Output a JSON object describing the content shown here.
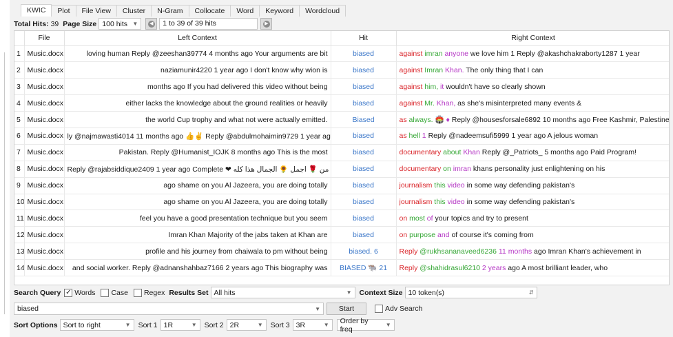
{
  "tabs": [
    "KWIC",
    "Plot",
    "File View",
    "Cluster",
    "N-Gram",
    "Collocate",
    "Word",
    "Keyword",
    "Wordcloud"
  ],
  "hits": {
    "total_label": "Total Hits:",
    "total": "39",
    "page_size_label": "Page Size",
    "page_size": "100 hits",
    "range": "1 to 39 of 39 hits"
  },
  "columns": [
    "",
    "File",
    "Left Context",
    "Hit",
    "Right Context"
  ],
  "rows": [
    {
      "n": "1",
      "file": "Music.docx",
      "left": "loving human Reply @zeeshan39774 4 months ago Your arguments are bit",
      "hit": "biased",
      "r1": "against",
      "r2": "imran",
      "r3": "anyone",
      "rest": "we love him 1 Reply @akashchakraborty1287 1 year"
    },
    {
      "n": "2",
      "file": "Music.docx",
      "left": "naziamunir4220 1 year ago I don't know why wion is",
      "hit": "biased",
      "r1": "against",
      "r2": "Imran",
      "r3": "Khan.",
      "rest": "The only thing that I can"
    },
    {
      "n": "3",
      "file": "Music.docx",
      "left": "months ago If you had delivered this video without being",
      "hit": "biased",
      "r1": "against",
      "r2": "him,",
      "r3": "it",
      "rest": "wouldn't have so clearly shown"
    },
    {
      "n": "4",
      "file": "Music.docx",
      "left": "either lacks the knowledge about the ground realities or heavily",
      "hit": "biased",
      "r1": "against",
      "r2": "Mr.",
      "r3": "Khan,",
      "rest": "as she's misinterpreted many events &"
    },
    {
      "n": "5",
      "file": "Music.docx",
      "left": "the world Cup trophy and what not were actually emitted.",
      "hit": "Biased",
      "r1": "as",
      "r2": "always.",
      "r3": "🏟️ ♦",
      "rest": "Reply @housesforsale6892 10 months ago Free Kashmir, Palestine."
    },
    {
      "n": "6",
      "file": "Music.docx",
      "left": "ly @najmawasti4014 11 months ago 👍✌ Reply @abdulmohaimin9729 1 year ago",
      "hit": "biased",
      "r1": "as",
      "r2": "hell",
      "r3": "1",
      "rest": "Reply @nadeemsufi5999 1 year ago A jelous woman"
    },
    {
      "n": "7",
      "file": "Music.docx",
      "left": "Pakistan. Reply @Humanist_IOJK 8 months ago This is the most",
      "hit": "biased",
      "r1": "documentary",
      "r2": "about",
      "r3": "Khan",
      "rest": "Reply @_Patriots_ 5 months ago Paid Program!"
    },
    {
      "n": "8",
      "file": "Music.docx",
      "left": "Reply @rajabsiddique2409 1 year ago Complete ❤ من 🌹 اجمل 🌻 الجمال هذا كله",
      "hit": "biased",
      "r1": "documentary",
      "r2": "on",
      "r3": "imran",
      "rest": "khans personality just enlightening on his"
    },
    {
      "n": "9",
      "file": "Music.docx",
      "left": "ago shame on you Al Jazeera, you are doing totally",
      "hit": "biased",
      "r1": "journalism",
      "r2": "this",
      "r3": "video",
      "rest": "in some way defending pakistan's"
    },
    {
      "n": "10",
      "file": "Music.docx",
      "left": "ago shame on you Al Jazeera, you are doing totally",
      "hit": "biased",
      "r1": "journalism",
      "r2": "this",
      "r3": "video",
      "rest": "in some way defending pakistan's"
    },
    {
      "n": "11",
      "file": "Music.docx",
      "left": "feel you have a good presentation technique but you seem",
      "hit": "biased",
      "r1": "on",
      "r2": "most",
      "r3": "of",
      "rest": "your topics and try to present"
    },
    {
      "n": "12",
      "file": "Music.docx",
      "left": "Imran Khan Majority of the jabs taken at Khan are",
      "hit": "biased",
      "r1": "on",
      "r2": "purpose",
      "r3": "and",
      "rest": "of course it's coming from"
    },
    {
      "n": "13",
      "file": "Music.docx",
      "left": "profile and his journey from chaiwala to pm without being",
      "hit": "biased. 6",
      "r1": "Reply",
      "r2": "@rukhsananaveed6236",
      "r3": "11 months",
      "rest": "ago Imran Khan's achievement in"
    },
    {
      "n": "14",
      "file": "Music.docx",
      "left": "and social worker. Reply @adnanshahbaz7166 2 years ago This biography was",
      "hit": "BIASED 🐃 21",
      "r1": "Reply",
      "r2": "@shahidrasul6210",
      "r3": "2 years",
      "rest": "ago A most brilliant leader, who"
    }
  ],
  "search": {
    "query_label": "Search Query",
    "words": "Words",
    "case": "Case",
    "regex": "Regex",
    "results_set_label": "Results Set",
    "results_set": "All hits",
    "context_size_label": "Context Size",
    "context_size": "10 token(s)",
    "query_value": "biased",
    "start": "Start",
    "adv_search": "Adv Search",
    "words_checked": true,
    "case_checked": false,
    "regex_checked": false,
    "adv_checked": false
  },
  "sort": {
    "label": "Sort Options",
    "mode": "Sort to right",
    "sort1_label": "Sort 1",
    "sort1": "1R",
    "sort2_label": "Sort 2",
    "sort2": "2R",
    "sort3_label": "Sort 3",
    "sort3": "3R",
    "order": "Order by freq"
  },
  "colors": {
    "hit": "#3d78c9",
    "r1": "#d9252a",
    "r2": "#36a736",
    "r3": "#b435c4"
  }
}
